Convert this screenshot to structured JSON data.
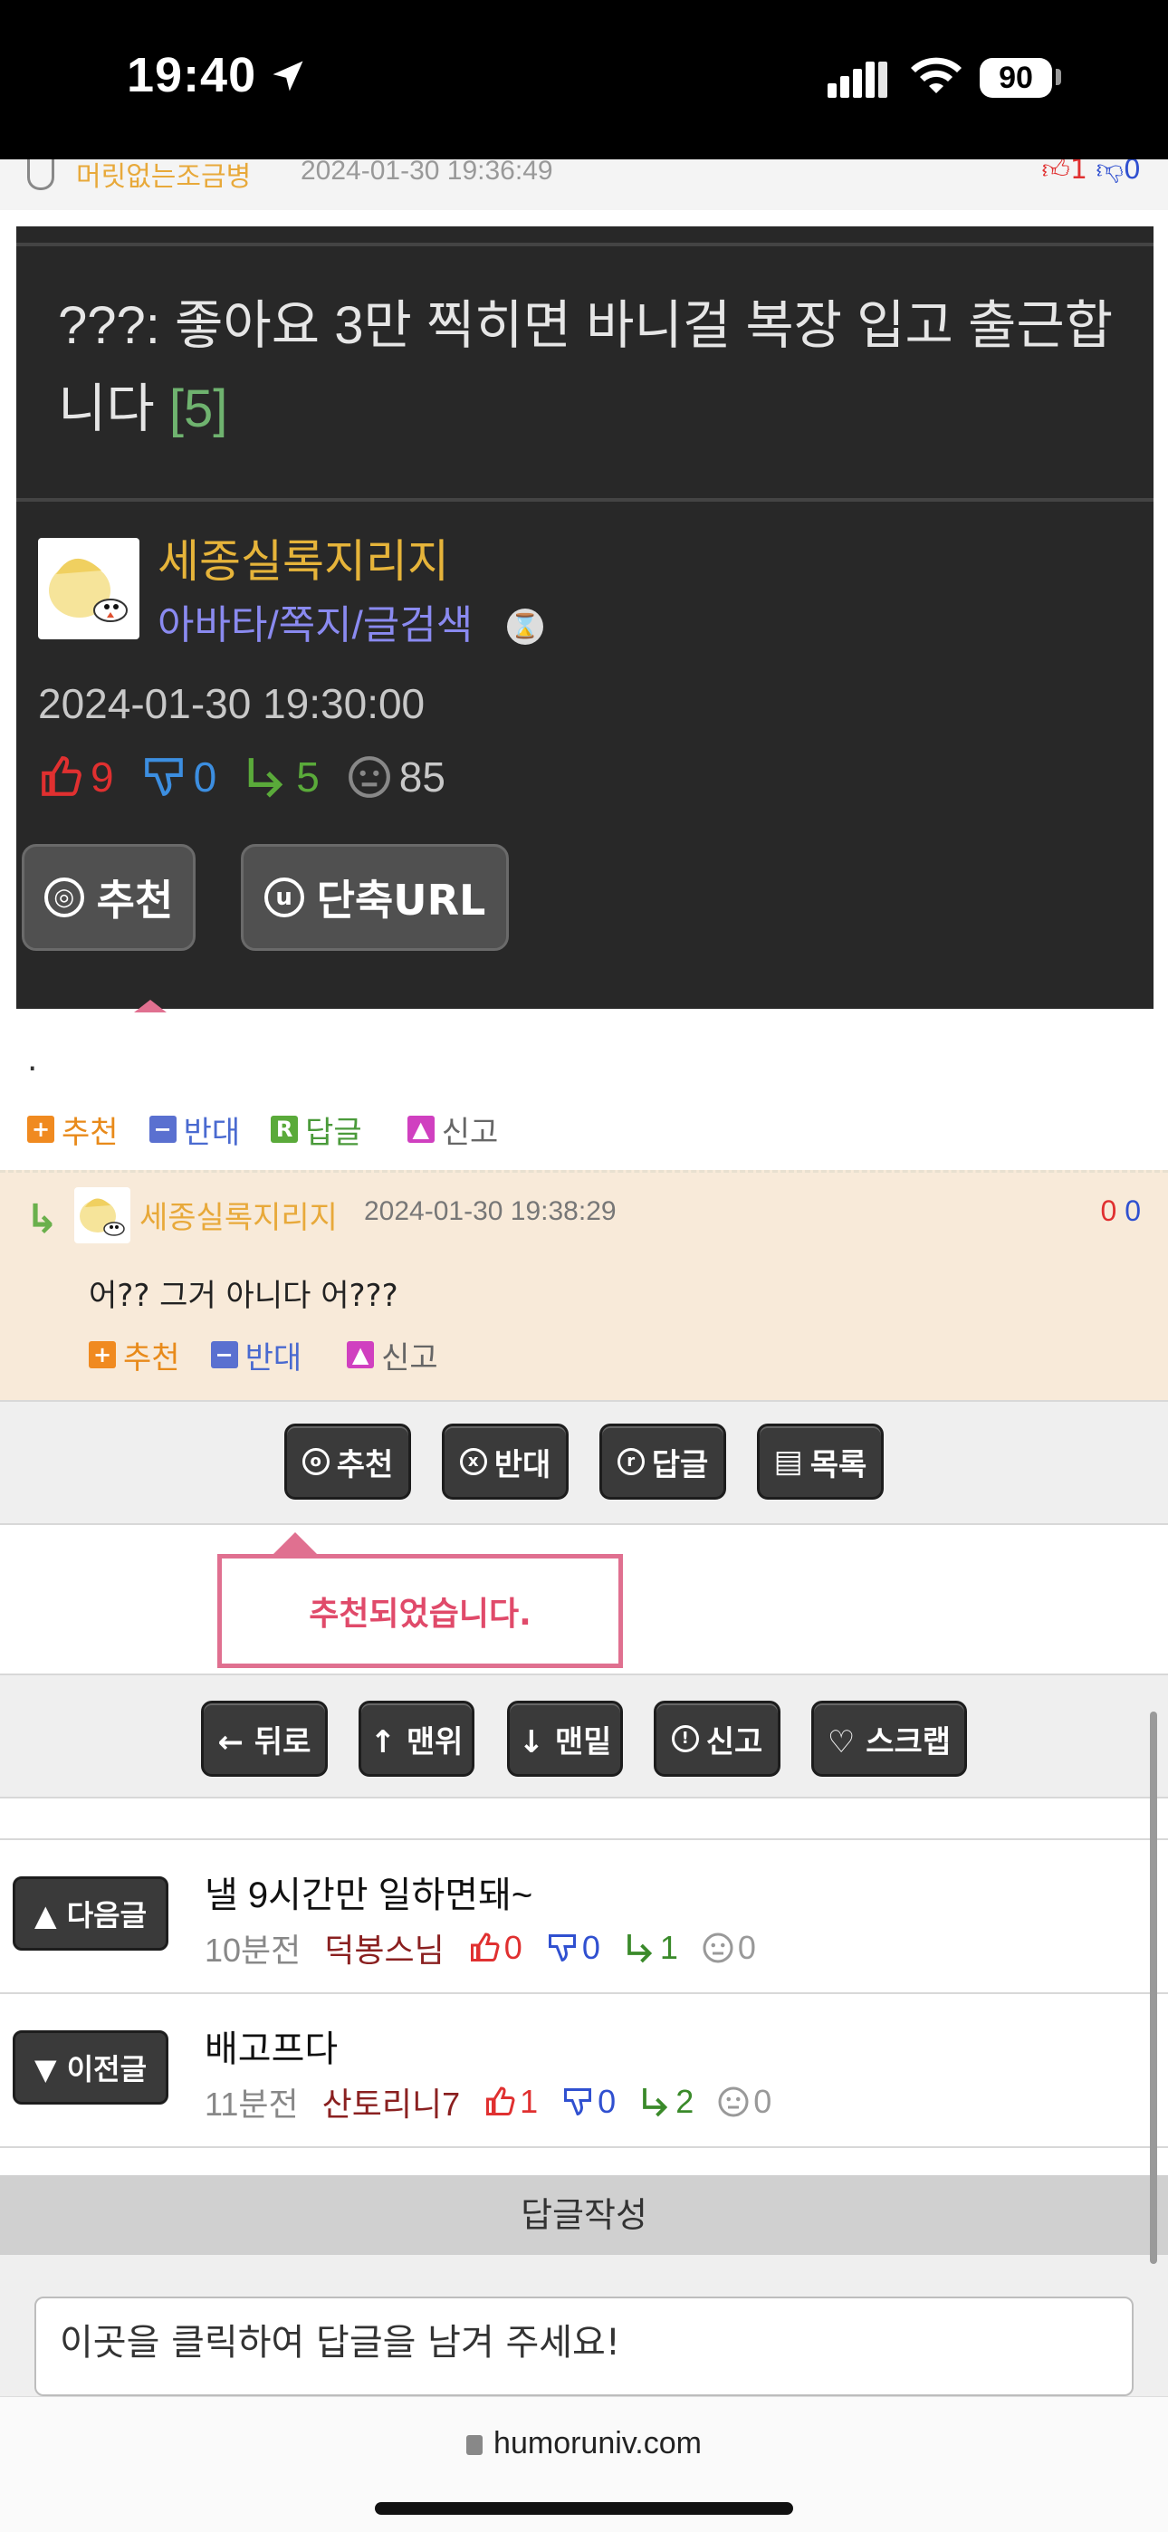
{
  "status_bar": {
    "time": "19:40",
    "battery": "90"
  },
  "prev_comment": {
    "name": "머릿없는조금병",
    "date": "2024-01-30 19:36:49",
    "up": "1",
    "down": "0"
  },
  "post": {
    "title": "???: 좋아요 3만 찍히면 바니걸 복장 입고 출근합니다",
    "comment_count": "[5]",
    "author": "세종실록지리지",
    "author_links": "아바타/쪽지/글검색",
    "date": "2024-01-30 19:30:00",
    "stats": {
      "up": "9",
      "down": "0",
      "replies": "5",
      "views": "85"
    },
    "buttons": {
      "recommend": "추천",
      "short_url": "단축URL"
    },
    "body": "."
  },
  "post_actions": {
    "recommend": "추천",
    "oppose": "반대",
    "reply": "답글",
    "report": "신고"
  },
  "reply_comment": {
    "name": "세종실록지리지",
    "date": "2024-01-30 19:38:29",
    "up": "0",
    "down": "0",
    "text": "어?? 그거 아니다 어???",
    "actions": {
      "recommend": "추천",
      "oppose": "반대",
      "report": "신고"
    }
  },
  "bar1": {
    "recommend": "추천",
    "oppose": "반대",
    "reply": "답글",
    "list": "목록"
  },
  "toast": "추천되었습니다.",
  "bar2": {
    "back": "← 뒤로",
    "top": "↑ 맨위",
    "bottom": "↓ 맨밑",
    "report": "신고",
    "scrap": "♡ 스크랩"
  },
  "next_post": {
    "label": "▲ 다음글",
    "title": "낼 9시간만 일하면돼~",
    "time": "10분전",
    "author": "덕봉스님",
    "up": "0",
    "down": "0",
    "replies": "1",
    "views": "0"
  },
  "prev_post": {
    "label": "▼ 이전글",
    "title": "배고프다",
    "time": "11분전",
    "author": "산토리니7",
    "up": "1",
    "down": "0",
    "replies": "2",
    "views": "0"
  },
  "reply_form": {
    "header": "답글작성",
    "placeholder": "이곳을 클릭하여 답글을 남겨 주세요!"
  },
  "browser": {
    "url": "humoruniv.com"
  },
  "colors": {
    "up": "#e03030",
    "down": "#3050d0",
    "reply": "#5aaa3a",
    "accent_pink": "#e07090",
    "author": "#e6b43a"
  }
}
